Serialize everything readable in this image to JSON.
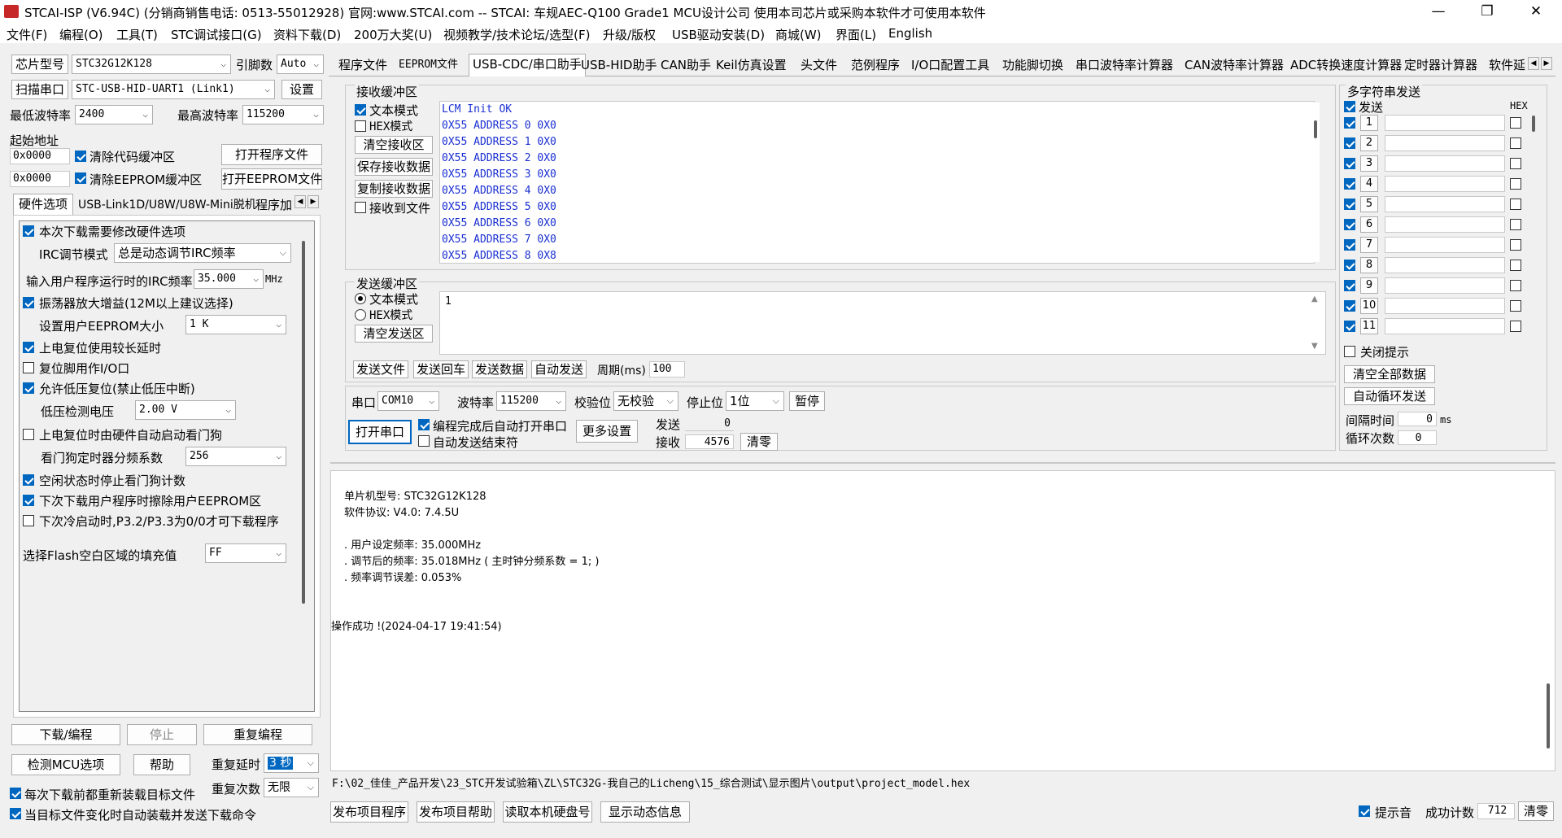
{
  "window": {
    "title": "STCAI-ISP (V6.94C) (分销商销售电话: 0513-55012928) 官网:www.STCAI.com  -- STCAI: 车规AEC-Q100 Grade1 MCU设计公司 使用本司芯片或采购本软件才可使用本软件",
    "minimize": "—",
    "maximize": "❐",
    "close": "✕"
  },
  "menu": [
    "文件(F)",
    "编程(O)",
    "工具(T)",
    "STC调试接口(G)",
    "资料下载(D)",
    "200万大奖(U)",
    "视频教学/技术论坛/选型(F)",
    "升级/版权",
    "USB驱动安装(D)",
    "商城(W)",
    "界面(L)",
    "English"
  ],
  "left": {
    "chip_label": "芯片型号",
    "chip_value": "STC32G12K128",
    "pins_label": "引脚数",
    "pins_value": "Auto",
    "scan_label": "扫描串口",
    "port_value": "STC-USB-HID-UART1 (Link1)",
    "settings_btn": "设置",
    "min_baud_label": "最低波特率",
    "min_baud_value": "2400",
    "max_baud_label": "最高波特率",
    "max_baud_value": "115200",
    "start_addr_label": "起始地址",
    "addr1": "0x0000",
    "clear_code_label": "清除代码缓冲区",
    "open_prog_btn": "打开程序文件",
    "addr2": "0x0000",
    "clear_eeprom_label": "清除EEPROM缓冲区",
    "open_eeprom_btn": "打开EEPROM文件",
    "tabs": [
      "硬件选项",
      "USB-Link1D/U8W/U8W-Mini脱机",
      "程序加"
    ],
    "opt_modify_hw": "本次下载需要修改硬件选项",
    "irc_mode_label": "IRC调节模式",
    "irc_mode_value": "总是动态调节IRC频率",
    "irc_freq_label": "输入用户程序运行时的IRC频率",
    "irc_freq_value": "35.000",
    "irc_freq_unit": "MHz",
    "opt_osc_gain": "振荡器放大增益(12M以上建议选择)",
    "eeprom_size_label": "设置用户EEPROM大小",
    "eeprom_size_value": "1   K",
    "opt_long_delay": "上电复位使用较长延时",
    "opt_reset_io": "复位脚用作I/O口",
    "opt_lvr": "允许低压复位(禁止低压中断)",
    "lvd_label": "低压检测电压",
    "lvd_value": "2.00 V",
    "opt_wdt_hw": "上电复位时由硬件自动启动看门狗",
    "wdt_div_label": "看门狗定时器分频系数",
    "wdt_div_value": "256",
    "opt_idle_wdt": "空闲状态时停止看门狗计数",
    "opt_erase_eeprom": "下次下载用户程序时擦除用户EEPROM区",
    "opt_p32": "下次冷启动时,P3.2/P3.3为0/0才可下载程序",
    "fill_label": "选择Flash空白区域的填充值",
    "fill_value": "FF",
    "download_btn": "下载/编程",
    "stop_btn": "停止",
    "reprog_btn": "重复编程",
    "detect_btn": "检测MCU选项",
    "help_btn": "帮助",
    "repeat_delay_label": "重复延时",
    "repeat_delay_value": "3 秒",
    "repeat_count_label": "重复次数",
    "repeat_count_value": "无限",
    "reload_label": "每次下载前都重新装载目标文件",
    "autoload_label": "当目标文件变化时自动装载并发送下载命令"
  },
  "right_tabs": [
    "程序文件",
    "EEPROM文件",
    "USB-CDC/串口助手",
    "USB-HID助手",
    "CAN助手",
    "Keil仿真设置",
    "头文件",
    "范例程序",
    "I/O口配置工具",
    "功能脚切换",
    "串口波特率计算器",
    "CAN波特率计算器",
    "ADC转换速度计算器",
    "定时器计算器",
    "软件延"
  ],
  "serial": {
    "recv_title": "接收缓冲区",
    "text_mode": "文本模式",
    "hex_mode": "HEX模式",
    "clear_recv": "清空接收区",
    "save_recv": "保存接收数据",
    "copy_recv": "复制接收数据",
    "recv_to_file": "接收到文件",
    "recv_lines": [
      "LCM Init OK",
      "0X55 ADDRESS 0 0X0",
      "0X55 ADDRESS 1 0X0",
      "0X55 ADDRESS 2 0X0",
      "0X55 ADDRESS 3 0X0",
      "0X55 ADDRESS 4 0X0",
      "0X55 ADDRESS 5 0X0",
      "0X55 ADDRESS 6 0X0",
      "0X55 ADDRESS 7 0X0",
      "0X55 ADDRESS 8 0X8"
    ],
    "send_title": "发送缓冲区",
    "send_text_mode": "文本模式",
    "send_hex_mode": "HEX模式",
    "clear_send": "清空发送区",
    "send_content": "1",
    "send_file": "发送文件",
    "send_cr": "发送回车",
    "send_data": "发送数据",
    "auto_send": "自动发送",
    "period_label": "周期(ms)",
    "period_value": "100",
    "port_label": "串口",
    "port_value": "COM10",
    "baud_label": "波特率",
    "baud_value": "115200",
    "parity_label": "校验位",
    "parity_value": "无校验",
    "stop_label": "停止位",
    "stop_value": "1位",
    "pause_btn": "暂停",
    "open_port_btn": "打开串口",
    "auto_open": "编程完成后自动打开串口",
    "auto_end": "自动发送结束符",
    "more_settings": "更多设置",
    "sent_label": "发送",
    "sent_value": "0",
    "recv_label": "接收",
    "recv_value": "4576",
    "clear_count": "清零"
  },
  "multi": {
    "title": "多字符串发送",
    "send_col": "发送",
    "hex_col": "HEX",
    "rows": [
      "1",
      "2",
      "3",
      "4",
      "5",
      "6",
      "7",
      "8",
      "9",
      "10",
      "11"
    ],
    "close_tip": "关闭提示",
    "clear_all": "清空全部数据",
    "auto_loop": "自动循环发送",
    "interval_label": "间隔时间",
    "interval_value": "0",
    "interval_unit": "ms",
    "loop_label": "循环次数",
    "loop_value": "0"
  },
  "log": {
    "lines": [
      "单片机型号: STC32G12K128",
      "软件协议: V4.0: 7.4.5U",
      "",
      ". 用户设定频率: 35.000MHz",
      ". 调节后的频率: 35.018MHz ( 主时钟分频系数 = 1; )",
      ". 频率调节误差: 0.053%",
      "",
      "",
      "操作成功 !(2024-04-17 19:41:54)"
    ]
  },
  "path": "F:\\02_佳佳_产品开发\\23_STC开发试验箱\\ZL\\STC32G-我自己的Licheng\\15_综合测试\\显示图片\\output\\project_model.hex",
  "bottom": {
    "publish_prog": "发布项目程序",
    "publish_help": "发布项目帮助",
    "read_disk": "读取本机硬盘号",
    "show_dynamic": "显示动态信息",
    "beep_label": "提示音",
    "success_label": "成功计数",
    "success_value": "712",
    "clear_btn": "清零"
  }
}
